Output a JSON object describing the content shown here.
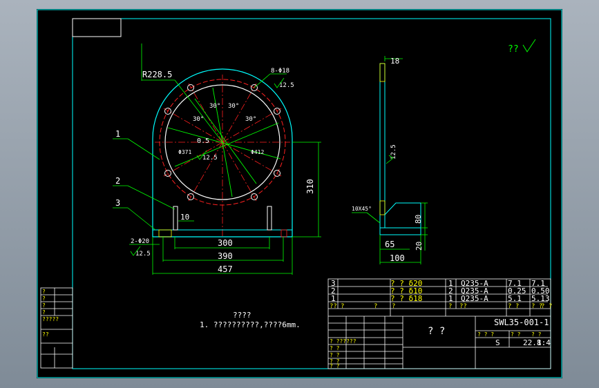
{
  "title_block": {
    "rows": [
      {
        "no": "3",
        "name": "? ? δ20",
        "qty": "1",
        "material": "Q235-A",
        "w1": "7.1",
        "w2": "7.1"
      },
      {
        "no": "2",
        "name": "? ? δ10",
        "qty": "2",
        "material": "Q235-A",
        "w1": "0.25",
        "w2": "0.50"
      },
      {
        "no": "1",
        "name": "? ? δ18",
        "qty": "1",
        "material": "Q235-A",
        "w1": "5.1",
        "w2": "5.13"
      }
    ],
    "header_row": [
      "??",
      "?",
      "?",
      "?",
      "?",
      "??",
      "? ?",
      "? ?",
      "? ?"
    ],
    "drawing_no": "SWL35-001-1",
    "part_name": "? ?",
    "scale_label": "1:4",
    "sheet_label": "S",
    "weight": "22.8",
    "sub_labels": [
      "? ? ?",
      "? ?",
      "? ?"
    ],
    "left_rows": [
      "? ??????",
      "? ?",
      "? ?",
      "? ?",
      "? ?"
    ]
  },
  "notes": {
    "heading": "????",
    "line1": "1. ??????????,????6mm."
  },
  "roughness_note": "??",
  "dimensions": {
    "radius": "R228.5",
    "holes": "8-Φ18",
    "hole_roughness": "12.5",
    "angle": "30°",
    "tolerance": "0.5",
    "d_inner": "Φ371",
    "d_pitch": "Φ412",
    "center_roughness": "12.5",
    "height": "310",
    "slot": "10",
    "width_300": "300",
    "width_390": "390",
    "width_457": "457",
    "base_holes": "2-Φ20",
    "base_roughness": "12.5",
    "side_top": "18",
    "side_roughness": "12.5",
    "chamfer": "10X45°",
    "side_80": "80",
    "side_65": "65",
    "side_20": "20",
    "side_100": "100"
  },
  "leaders": [
    "1",
    "2",
    "3"
  ],
  "left_strip_rows": [
    "?",
    "?",
    "?",
    "?",
    "??",
    "?????"
  ],
  "colors": {
    "line": "#00ff00",
    "dim": "#00e0e0",
    "red": "#ff2020",
    "white": "#ffffff",
    "yellow": "#ffff00",
    "frame": "#00ffff"
  }
}
